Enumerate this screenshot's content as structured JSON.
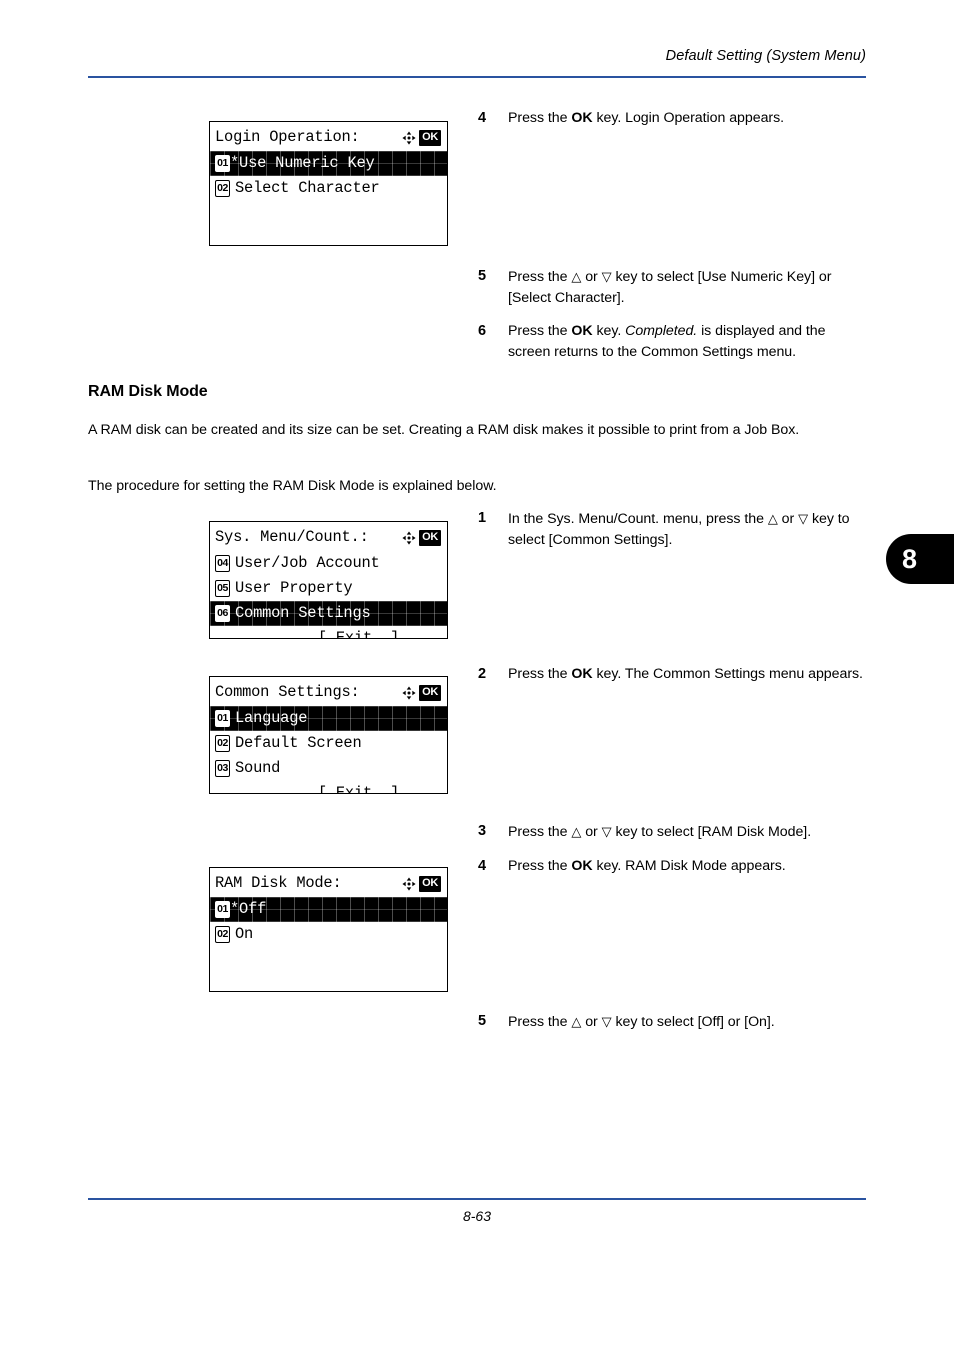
{
  "header": {
    "title": "Default Setting (System Menu)",
    "rule_color": "#2a53a0"
  },
  "footer": {
    "page_number": "8-63",
    "rule_color": "#2a53a0"
  },
  "page_tab": {
    "label": "8"
  },
  "sections": {
    "ram_disk_mode": {
      "heading": "RAM Disk Mode",
      "paragraph_1": "A RAM disk can be created and its size can be set. Creating a RAM disk makes it possible to print from a Job Box.",
      "paragraph_2": "The procedure for setting the RAM Disk Mode is explained below."
    }
  },
  "steps_top": [
    {
      "number": "4",
      "segments": [
        {
          "text": "Press the ",
          "style": "normal"
        },
        {
          "text": "OK",
          "style": "bold"
        },
        {
          "text": " key. Login Operation appears.",
          "style": "normal"
        }
      ]
    },
    {
      "number": "5",
      "segments": [
        {
          "text": "Press the ",
          "style": "normal"
        },
        {
          "text": "△",
          "style": "symbol"
        },
        {
          "text": " or ",
          "style": "normal"
        },
        {
          "text": "▽",
          "style": "symbol"
        },
        {
          "text": " key to select [Use Numeric Key] or [Select Character].",
          "style": "normal"
        }
      ]
    },
    {
      "number": "6",
      "segments": [
        {
          "text": "Press the ",
          "style": "normal"
        },
        {
          "text": "OK",
          "style": "bold"
        },
        {
          "text": " key. ",
          "style": "normal"
        },
        {
          "text": "Completed.",
          "style": "italic"
        },
        {
          "text": " is displayed and the screen returns to the Common Settings menu.",
          "style": "normal"
        }
      ]
    }
  ],
  "steps_bottom": [
    {
      "number": "1",
      "segments": [
        {
          "text": "In the Sys. Menu/Count. menu, press the ",
          "style": "normal"
        },
        {
          "text": "△",
          "style": "symbol"
        },
        {
          "text": " or ",
          "style": "normal"
        },
        {
          "text": "▽",
          "style": "symbol"
        },
        {
          "text": " key to select [Common Settings].",
          "style": "normal"
        }
      ]
    },
    {
      "number": "2",
      "segments": [
        {
          "text": "Press the ",
          "style": "normal"
        },
        {
          "text": "OK",
          "style": "bold"
        },
        {
          "text": " key. The Common Settings menu appears.",
          "style": "normal"
        }
      ]
    },
    {
      "number": "3",
      "segments": [
        {
          "text": "Press the ",
          "style": "normal"
        },
        {
          "text": "△",
          "style": "symbol"
        },
        {
          "text": " or ",
          "style": "normal"
        },
        {
          "text": "▽",
          "style": "symbol"
        },
        {
          "text": " key to select [RAM Disk Mode].",
          "style": "normal"
        }
      ]
    },
    {
      "number": "4",
      "segments": [
        {
          "text": "Press the ",
          "style": "normal"
        },
        {
          "text": "OK",
          "style": "bold"
        },
        {
          "text": " key. RAM Disk Mode appears.",
          "style": "normal"
        }
      ]
    },
    {
      "number": "5",
      "segments": [
        {
          "text": "Press the ",
          "style": "normal"
        },
        {
          "text": "△",
          "style": "symbol"
        },
        {
          "text": " or ",
          "style": "normal"
        },
        {
          "text": "▽",
          "style": "symbol"
        },
        {
          "text": " key to select [Off] or [On].",
          "style": "normal"
        }
      ]
    }
  ],
  "lcd_panels": {
    "login_operation": {
      "title": "Login Operation:",
      "ok_key_label": "OK",
      "nav_icon": "four-way-arrow-icon",
      "rows": [
        {
          "num": "01",
          "label": "*Use Numeric Key",
          "selected": true,
          "tight": true
        },
        {
          "num": "02",
          "label": "Select Character",
          "selected": false,
          "tight": false
        }
      ],
      "exit_label": null,
      "blank_rows": 2
    },
    "sys_menu_count": {
      "title": "Sys. Menu/Count.:",
      "ok_key_label": "OK",
      "nav_icon": "four-way-arrow-icon",
      "rows": [
        {
          "num": "04",
          "label": "User/Job Account",
          "selected": false,
          "tight": false
        },
        {
          "num": "05",
          "label": "User Property",
          "selected": false,
          "tight": false
        },
        {
          "num": "06",
          "label": "Common Settings",
          "selected": true,
          "tight": false
        }
      ],
      "exit_label": "[ Exit  ]",
      "blank_rows": 0
    },
    "common_settings": {
      "title": "Common Settings:",
      "ok_key_label": "OK",
      "nav_icon": "four-way-arrow-icon",
      "rows": [
        {
          "num": "01",
          "label": "Language",
          "selected": true,
          "tight": false
        },
        {
          "num": "02",
          "label": "Default Screen",
          "selected": false,
          "tight": false
        },
        {
          "num": "03",
          "label": "Sound",
          "selected": false,
          "tight": false
        }
      ],
      "exit_label": "[ Exit  ]",
      "blank_rows": 0
    },
    "ram_disk_mode": {
      "title": "RAM Disk Mode:",
      "ok_key_label": "OK",
      "nav_icon": "four-way-arrow-icon",
      "rows": [
        {
          "num": "01",
          "label": "*Off",
          "selected": true,
          "tight": true
        },
        {
          "num": "02",
          "label": "On",
          "selected": false,
          "tight": false
        }
      ],
      "exit_label": null,
      "blank_rows": 2
    }
  }
}
